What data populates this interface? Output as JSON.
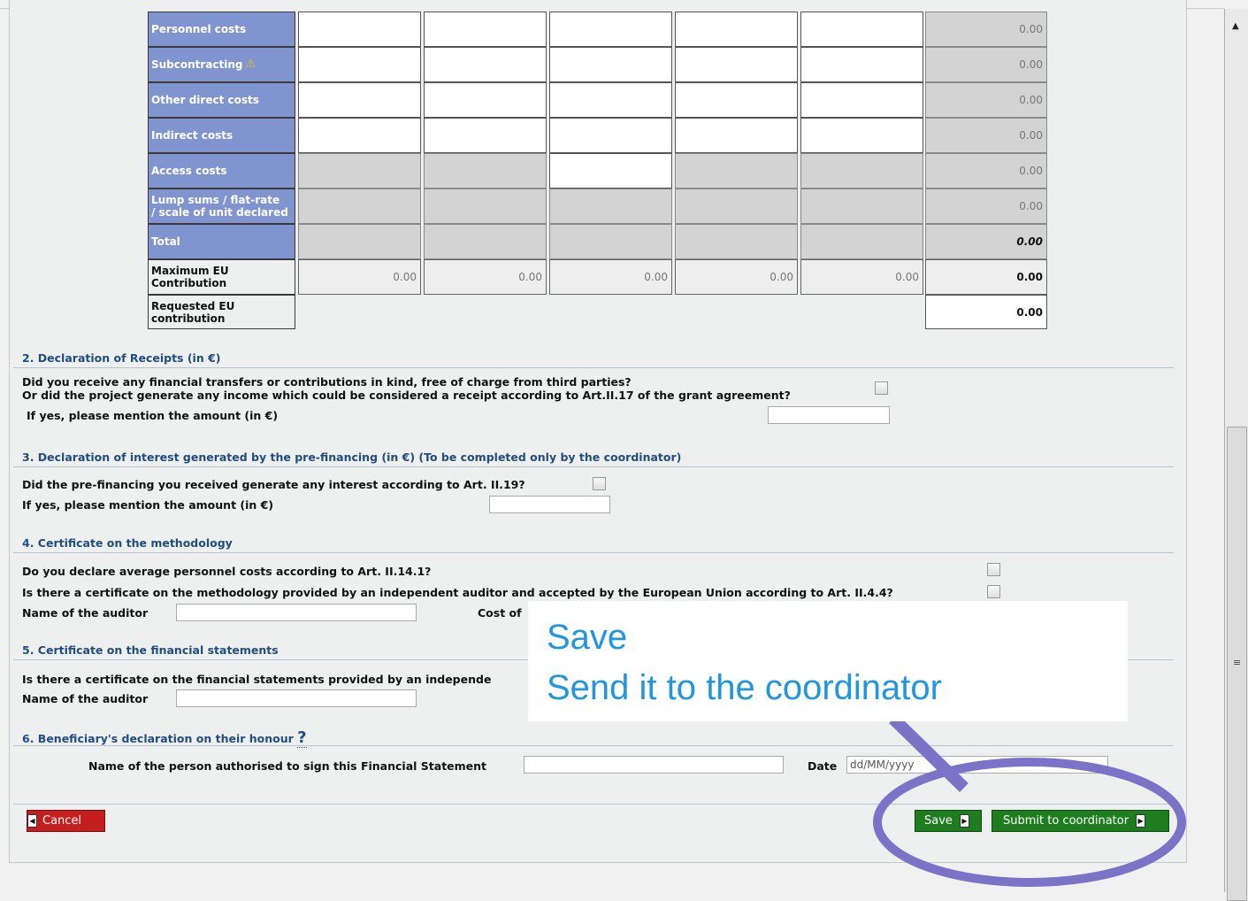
{
  "cost_table": {
    "rows": [
      {
        "label": "Personnel costs",
        "total": "0.00"
      },
      {
        "label": "Subcontracting",
        "total": "0.00"
      },
      {
        "label": "Other direct costs",
        "total": "0.00"
      },
      {
        "label": "Indirect costs",
        "total": "0.00"
      },
      {
        "label": "Access costs",
        "total": "0.00"
      },
      {
        "label_line1": "Lump sums / flat-rate",
        "label_line2": "/ scale of unit declared",
        "total": "0.00"
      },
      {
        "label": "Total",
        "total": "0.00"
      }
    ],
    "max_eu": {
      "line1": "Maximum EU",
      "line2": "Contribution",
      "values": [
        "0.00",
        "0.00",
        "0.00",
        "0.00",
        "0.00"
      ],
      "total": "0.00"
    },
    "requested_eu": {
      "line1": "Requested EU",
      "line2": "contribution",
      "total": "0.00"
    }
  },
  "section2": {
    "title": "2. Declaration of Receipts (in €)",
    "q1": "Did you receive any financial transfers or contributions in kind, free of charge from third parties?",
    "q2": "Or did the project generate any income which could be considered a receipt according to Art.II.17 of the grant agreement?",
    "amount_label": "If yes, please mention the amount (in €)"
  },
  "section3": {
    "title": "3. Declaration of interest generated by the pre-financing (in €) (To be completed only by the coordinator)",
    "q1": "Did the pre-financing you received generate any interest according to Art. II.19?",
    "amount_label": "If yes, please mention the amount (in €)"
  },
  "section4": {
    "title": "4. Certificate on the methodology",
    "q1": "Do you declare average personnel costs according to Art. II.14.1?",
    "q2": "Is there a certificate on the methodology provided by an independent auditor and accepted by the European Union according to Art. II.4.4?",
    "auditor_label": "Name of the auditor",
    "cost_label": "Cost of"
  },
  "section5": {
    "title": "5. Certificate on the financial statements",
    "q1": "Is there a certificate on the financial statements provided by an independe",
    "auditor_label": "Name of the auditor"
  },
  "section6": {
    "title": "6. Beneficiary's declaration on their honour",
    "help": "?",
    "name_label": "Name of the person authorised to sign this Financial Statement",
    "date_label": "Date",
    "date_placeholder": "dd/MM/yyyy"
  },
  "buttons": {
    "cancel": "Cancel",
    "save": "Save",
    "submit": "Submit to coordinator"
  },
  "callout": {
    "line1": "Save",
    "line2": "Send it to the coordinator"
  },
  "colors": {
    "label_blue": "#8095cf",
    "section_blue": "#1f4d80",
    "save_green": "#1e7d1e",
    "cancel_red": "#c41e1e",
    "callout_text": "#1f96dd",
    "ellipse": "#7b73c8"
  }
}
